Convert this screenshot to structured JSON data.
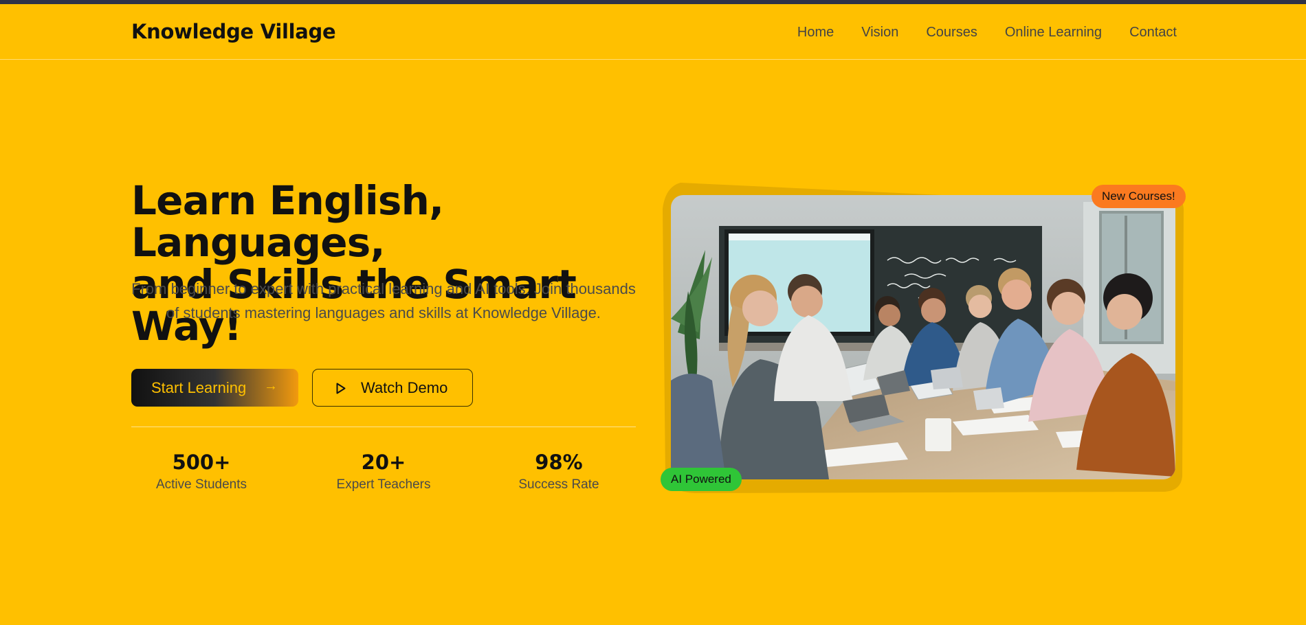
{
  "header": {
    "brand": "Knowledge Village",
    "nav": [
      "Home",
      "Vision",
      "Courses",
      "Online Learning",
      "Contact"
    ]
  },
  "hero": {
    "title_line1": "Learn English, Languages,",
    "title_line2": "and Skills the Smart Way!",
    "subtitle": "From beginner to expert with practical learning and AI tools. Join thousands of students mastering languages and skills at Knowledge Village.",
    "primary_button": "Start Learning",
    "primary_button_icon": "arrow-right-icon",
    "secondary_button": "Watch Demo",
    "secondary_button_icon": "play-icon"
  },
  "stats": [
    {
      "value": "500+",
      "label": "Active Students"
    },
    {
      "value": "20+",
      "label": "Expert Teachers"
    },
    {
      "value": "98%",
      "label": "Success Rate"
    }
  ],
  "media": {
    "badge_top": "New Courses!",
    "badge_bottom": "AI Powered"
  },
  "colors": {
    "background": "#ffc000",
    "dark": "#111111",
    "badge_orange": "#fb7a1f",
    "badge_green": "#2fc537",
    "top_strip": "#2f3347"
  }
}
